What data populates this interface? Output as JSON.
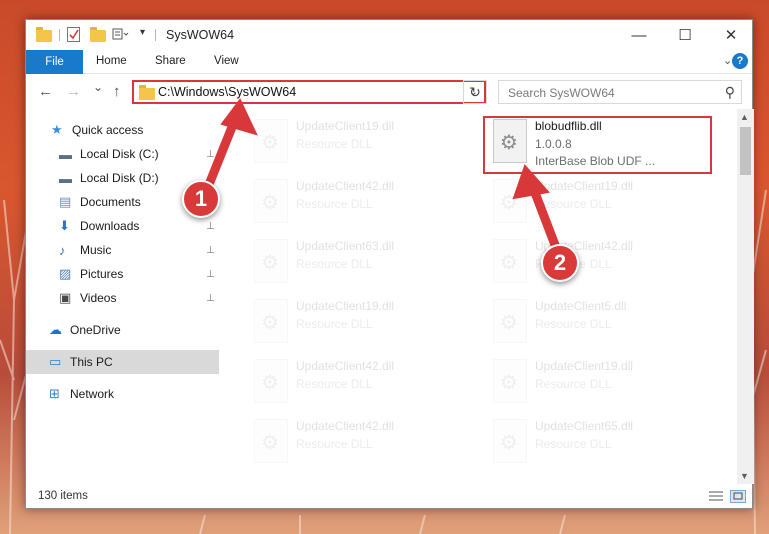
{
  "window": {
    "title": "SysWOW64",
    "minimize_symbol": "—",
    "maximize_symbol": "☐",
    "close_symbol": "✕"
  },
  "ribbon": {
    "tabs": [
      "File",
      "Home",
      "Share",
      "View"
    ],
    "collapse_symbol": "⌄",
    "help_symbol": "?"
  },
  "nav": {
    "back": "←",
    "forward": "→",
    "recent": "⌄",
    "up": "↑",
    "address": "C:\\Windows\\SysWOW64",
    "address_chevron": "⌄",
    "refresh": "↻",
    "search_placeholder": "Search SysWOW64",
    "search_symbol": "⚲"
  },
  "sidebar": {
    "items": [
      {
        "label": "Quick access",
        "icon": "star-icon",
        "glyph": "★",
        "color": "#3a8de0",
        "pinned": false
      },
      {
        "label": "Local Disk (C:)",
        "icon": "drive-icon",
        "glyph": "▬",
        "color": "#5a6f84",
        "pinned": true
      },
      {
        "label": "Local Disk (D:)",
        "icon": "drive-icon",
        "glyph": "▬",
        "color": "#5a6f84",
        "pinned": true
      },
      {
        "label": "Documents",
        "icon": "documents-icon",
        "glyph": "▤",
        "color": "#6c8db8",
        "pinned": true
      },
      {
        "label": "Downloads",
        "icon": "download-icon",
        "glyph": "⬇",
        "color": "#2b73c6",
        "pinned": true
      },
      {
        "label": "Music",
        "icon": "music-icon",
        "glyph": "♪",
        "color": "#2b73c6",
        "pinned": true
      },
      {
        "label": "Pictures",
        "icon": "pictures-icon",
        "glyph": "▨",
        "color": "#4b7fb7",
        "pinned": true
      },
      {
        "label": "Videos",
        "icon": "videos-icon",
        "glyph": "▣",
        "color": "#4a4a4a",
        "pinned": true
      },
      {
        "label": "OneDrive",
        "icon": "cloud-icon",
        "glyph": "☁",
        "color": "#1f72c6",
        "pinned": false
      },
      {
        "label": "This PC",
        "icon": "computer-icon",
        "glyph": "▭",
        "color": "#2f7fc1",
        "pinned": false,
        "selected": true
      },
      {
        "label": "Network",
        "icon": "network-icon",
        "glyph": "⊞",
        "color": "#3a7fc5",
        "pinned": false
      }
    ],
    "pin_symbol": "📌"
  },
  "files": [
    {
      "name": "UpdateClient19.dll",
      "type": "Resource DLL",
      "faded": true
    },
    {
      "name": "blobudflib.dll",
      "type": "1.0.0.8",
      "extra": "InterBase Blob UDF ...",
      "faded": false
    },
    {
      "name": "UpdateClient42.dll",
      "type": "Resource DLL",
      "faded": true
    },
    {
      "name": "UpdateClient19.dll",
      "type": "Resource DLL",
      "faded": true
    },
    {
      "name": "UpdateClient63.dll",
      "type": "Resource DLL",
      "faded": true
    },
    {
      "name": "UpdateClient42.dll",
      "type": "Resource DLL",
      "faded": true
    },
    {
      "name": "UpdateClient19.dll",
      "type": "Resource DLL",
      "faded": true
    },
    {
      "name": "UpdateClient5.dll",
      "type": "Resource DLL",
      "faded": true
    },
    {
      "name": "UpdateClient42.dll",
      "type": "Resource DLL",
      "faded": true
    },
    {
      "name": "UpdateClient19.dll",
      "type": "Resource DLL",
      "faded": true
    },
    {
      "name": "UpdateClient42.dll",
      "type": "Resource DLL",
      "faded": true
    },
    {
      "name": "UpdateClient65.dll",
      "type": "Resource DLL",
      "faded": true
    }
  ],
  "status": {
    "item_count": "130 items"
  },
  "annotations": {
    "callout_1": "1",
    "callout_2": "2",
    "accent_color": "#d9383a"
  }
}
